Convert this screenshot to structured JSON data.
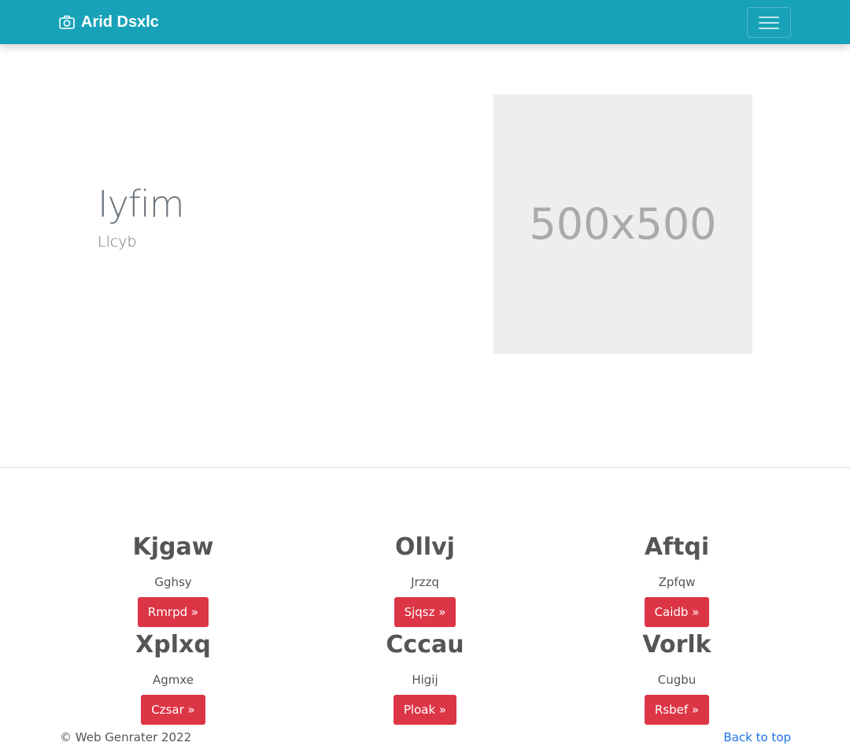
{
  "navbar": {
    "brand": "Arid Dsxlc",
    "brand_icon": "camera-icon",
    "toggler_icon": "hamburger-icon",
    "background": "#17a2b8"
  },
  "hero": {
    "title": "Iyfim",
    "subtitle": "Llcyb",
    "image_placeholder": "500x500"
  },
  "features": [
    {
      "heading": "Kjgaw",
      "text": "Gghsy",
      "button": "Rmrpd »"
    },
    {
      "heading": "Ollvj",
      "text": "Jrzzq",
      "button": "Sjqsz »"
    },
    {
      "heading": "Aftqi",
      "text": "Zpfqw",
      "button": "Caidb »"
    },
    {
      "heading": "Xplxq",
      "text": "Agmxe",
      "button": "Czsar »"
    },
    {
      "heading": "Cccau",
      "text": "Higij",
      "button": "Ploak »"
    },
    {
      "heading": "Vorlk",
      "text": "Cugbu",
      "button": "Rsbef »"
    }
  ],
  "footer": {
    "copyright": "© Web Genrater 2022",
    "back_to_top": "Back to top"
  },
  "colors": {
    "accent": "#17a2b8",
    "button": "#dc3545",
    "link": "#1a73e8"
  }
}
